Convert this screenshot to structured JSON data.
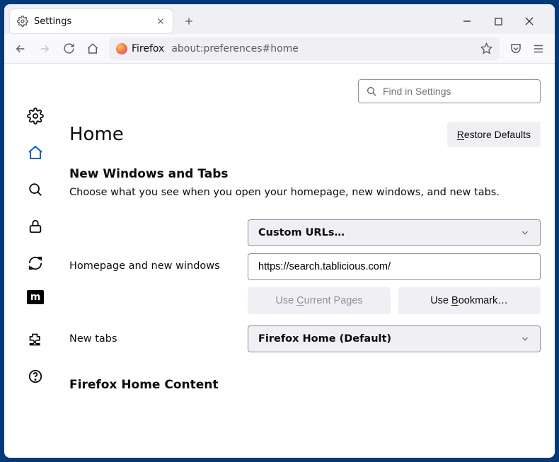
{
  "tab": {
    "title": "Settings"
  },
  "url": {
    "context": "Firefox",
    "value": "about:preferences#home"
  },
  "search": {
    "placeholder": "Find in Settings"
  },
  "page": {
    "title": "Home",
    "restore": "Restore Defaults"
  },
  "section1": {
    "title": "New Windows and Tabs",
    "desc": "Choose what you see when you open your homepage, new windows, and new tabs."
  },
  "homepage": {
    "label": "Homepage and new windows",
    "select": "Custom URLs…",
    "url": "https://search.tablicious.com/",
    "use_current": "Use Current Pages",
    "use_bookmark": "Use Bookmark…"
  },
  "newtabs": {
    "label": "New tabs",
    "select": "Firefox Home (Default)"
  },
  "fhc": {
    "title": "Firefox Home Content"
  }
}
